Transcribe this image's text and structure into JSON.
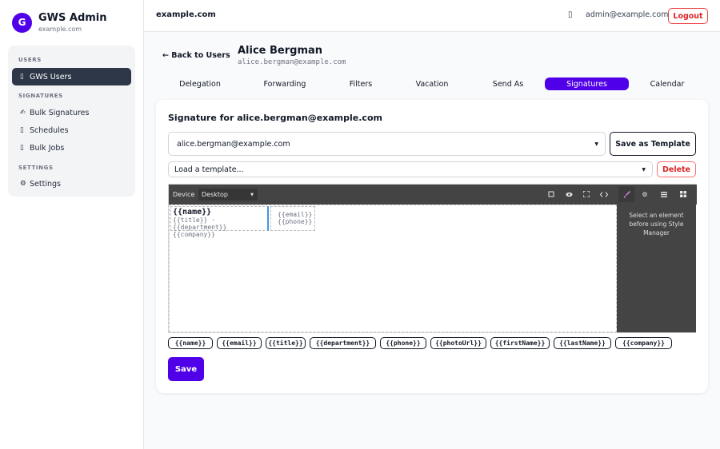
{
  "brand": {
    "initial": "G",
    "title": "GWS Admin",
    "domain": "example.com"
  },
  "sidebar": {
    "sections": [
      {
        "label": "USERS"
      },
      {
        "label": "SIGNATURES"
      },
      {
        "label": "SETTINGS"
      }
    ],
    "items": [
      {
        "icon": "▯",
        "label": "GWS Users"
      },
      {
        "icon": "✍",
        "label": "Bulk Signatures"
      },
      {
        "icon": "▯",
        "label": "Schedules"
      },
      {
        "icon": "▯",
        "label": "Bulk Jobs"
      },
      {
        "icon": "⚙",
        "label": "Settings"
      }
    ]
  },
  "header": {
    "domain": "example.com",
    "bell_icon": "▯",
    "user_email": "admin@example.com",
    "logout_label": "Logout"
  },
  "user": {
    "back_label": "← Back to Users",
    "name": "Alice Bergman",
    "email": "alice.bergman@example.com"
  },
  "tabs": [
    {
      "label": "Delegation"
    },
    {
      "label": "Forwarding"
    },
    {
      "label": "Filters"
    },
    {
      "label": "Vacation"
    },
    {
      "label": "Send As"
    },
    {
      "label": "Signatures"
    },
    {
      "label": "Calendar"
    }
  ],
  "signature": {
    "title": "Signature for alice.bergman@example.com",
    "send_as_value": "alice.bergman@example.com",
    "save_template_label": "Save as Template",
    "template_placeholder": "Load a template...",
    "delete_label": "Delete",
    "editor": {
      "device_label": "Device",
      "device_value": "Desktop",
      "tool_icons": [
        "square-outline-icon",
        "eye-icon",
        "fullscreen-icon",
        "code-icon",
        "paintbrush-icon",
        "gear-icon",
        "layers-icon",
        "blocks-icon"
      ],
      "content": {
        "name": "{{name}}",
        "title_line": "{{title}} · {{department}}",
        "company_line": "{{company}}",
        "email": "{{email}}",
        "phone": "{{phone}}"
      },
      "style_panel_text": "Select an element before using Style Manager"
    },
    "placeholders": [
      "{{name}}",
      "{{email}}",
      "{{title}}",
      "{{department}}",
      "{{phone}}",
      "{{photoUrl}}",
      "{{firstName}}",
      "{{lastName}}",
      "{{company}}"
    ],
    "save_label": "Save"
  },
  "colors": {
    "accent": "#4f00e8",
    "danger": "#dc2626",
    "sidebar_active": "#2d3748",
    "editor_bar": "#444444"
  }
}
